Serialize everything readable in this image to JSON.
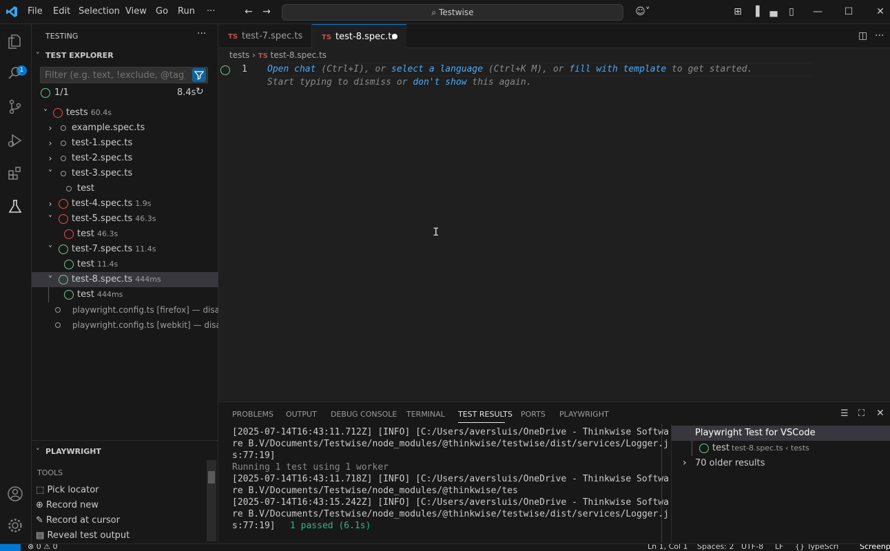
{
  "menu": [
    "File",
    "Edit",
    "Selection",
    "View",
    "Go",
    "Run",
    "···"
  ],
  "search": {
    "label": "Testwise"
  },
  "activity": {
    "explorer_badge": "1"
  },
  "sidebar": {
    "title": "TESTING",
    "more": "···",
    "section_title": "TEST EXPLORER",
    "filter_placeholder": "Filter (e.g. text, !exclude, @tag)",
    "summary_count": "1/1",
    "summary_time": "8.4s",
    "tree": [
      {
        "label": "tests",
        "duration": "60.4s"
      },
      {
        "label": "example.spec.ts",
        "duration": ""
      },
      {
        "label": "test-1.spec.ts",
        "duration": ""
      },
      {
        "label": "test-2.spec.ts",
        "duration": ""
      },
      {
        "label": "test-3.spec.ts",
        "duration": ""
      },
      {
        "label": "test",
        "duration": ""
      },
      {
        "label": "test-4.spec.ts",
        "duration": "1.9s"
      },
      {
        "label": "test-5.spec.ts",
        "duration": "46.3s"
      },
      {
        "label": "test",
        "duration": "46.3s"
      },
      {
        "label": "test-7.spec.ts",
        "duration": "11.4s"
      },
      {
        "label": "test",
        "duration": "11.4s"
      },
      {
        "label": "test-8.spec.ts",
        "duration": "444ms"
      },
      {
        "label": "test",
        "duration": "444ms"
      },
      {
        "label": "playwright.config.ts [firefox] — disabled",
        "duration": ""
      },
      {
        "label": "playwright.config.ts [webkit] — disabled",
        "duration": ""
      }
    ],
    "playwright": {
      "title": "PLAYWRIGHT",
      "tools_title": "TOOLS",
      "tools": [
        "Pick locator",
        "Record new",
        "Record at cursor",
        "Reveal test output"
      ]
    }
  },
  "editor": {
    "tabs": [
      {
        "label": "test-7.spec.ts",
        "lang": "TS"
      },
      {
        "label": "test-8.spec.ts",
        "lang": "TS"
      }
    ],
    "breadcrumb": [
      "tests",
      "test-8.spec.ts"
    ],
    "line_number": "1",
    "hint": {
      "open_chat": "Open chat",
      "t1": " (Ctrl+I), or ",
      "select_language": "select a language",
      "t2": " (Ctrl+K M), or ",
      "fill_template": "fill with template",
      "t3": " to get started.",
      "t4": "Start typing to dismiss or ",
      "dont_show": "don't show",
      "t5": " this again."
    }
  },
  "panel": {
    "tabs": [
      "PROBLEMS",
      "OUTPUT",
      "DEBUG CONSOLE",
      "TERMINAL",
      "TEST RESULTS",
      "PORTS",
      "PLAYWRIGHT"
    ],
    "active_tab": "TEST RESULTS",
    "log": [
      "[2025-07-14T16:43:11.712Z] [INFO] [C:/Users/aversluis/OneDrive - Thinkwise Softwa",
      "re B.V/Documents/Testwise/node_modules/@thinkwise/testwise/dist/services/Logger.j",
      "s:77:19]",
      "Running 1 test using 1 worker",
      "[2025-07-14T16:43:11.718Z] [INFO] [C:/Users/aversluis/OneDrive - Thinkwise Softwa",
      "re B.V/Documents/Testwise/node_modules/@thinkwise/tes",
      "[2025-07-14T16:43:15.242Z] [INFO] [C:/Users/aversluis/OneDrive - Thinkwise Softwa",
      "re B.V/Documents/Testwise/node_modules/@thinkwise/testwise/dist/services/Logger.j",
      "s:77:19]",
      "1 passed (6.1s)"
    ],
    "results": {
      "run_title": "Playwright Test for VSCode",
      "test_label": "test",
      "test_path": "test-8.spec.ts ‹ tests",
      "older": "70 older results"
    }
  },
  "statusbar": {
    "problems": "0",
    "warnings": "0",
    "position": "Ln 1, Col 1",
    "spaces": "Spaces: 2",
    "encoding": "UTF-8",
    "eol": "LF",
    "language": "{} TypeScri",
    "screenpresso": "Screenp"
  }
}
